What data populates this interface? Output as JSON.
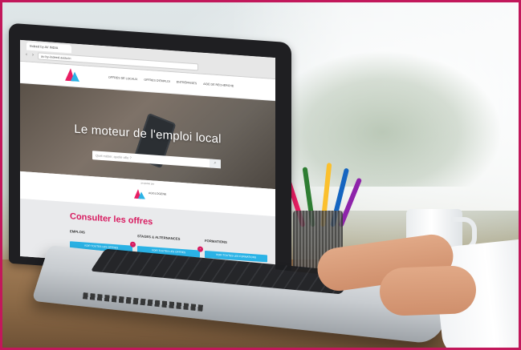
{
  "browser": {
    "tab_title": "Indeed by AV INDIA",
    "url": "av-by-indeed.aviav.in",
    "back_icon": "arrow-left-icon",
    "forward_icon": "arrow-right-icon",
    "reload_icon": "reload-icon"
  },
  "site": {
    "nav": [
      "OFFRES DE LOCAUX",
      "OFFRES D'EMPLOI",
      "ENTREPRISES",
      "AIDE DE RECHERCHE"
    ],
    "hero_title": "Le moteur de l'emploi local",
    "search_placeholder": "Quel métier, quelle ville ?",
    "search_icon": "search-icon",
    "sponsor_caption": "propulsé par",
    "sponsor_name": "AGGLOGENE",
    "offers_title": "Consulter les offres",
    "columns": [
      {
        "label": "EMPLOIS",
        "button": "VOIR TOUTES LES OFFRES",
        "badge": "+"
      },
      {
        "label": "STAGES & ALTERNANCES",
        "button": "VOIR TOUTES LES OFFRES",
        "badge": "+"
      },
      {
        "label": "FORMATIONS",
        "button": "VOIR TOUTES LES FORMATIONS",
        "badge": ""
      }
    ]
  },
  "colors": {
    "frame": "#c2185b",
    "brand": "#d81b60",
    "button": "#2bb3e6"
  }
}
